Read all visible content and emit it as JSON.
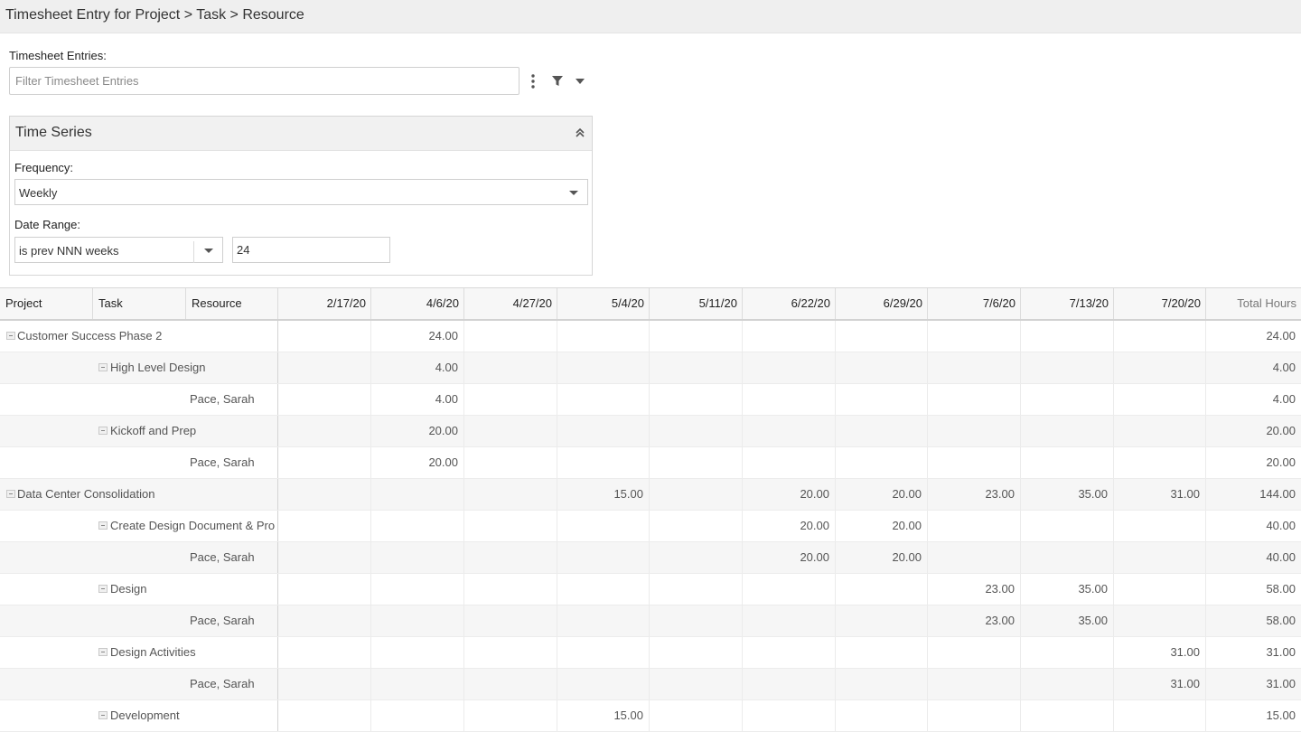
{
  "page_title": "Timesheet Entry for Project > Task > Resource",
  "filter": {
    "label": "Timesheet Entries:",
    "placeholder": "Filter Timesheet Entries"
  },
  "icons": {
    "more": "more-vertical-icon",
    "filter": "filter-icon",
    "dropdown": "chevron-down-icon",
    "collapse": "double-chevron-up-icon",
    "tree_toggle": "collapse-minus-icon"
  },
  "time_series": {
    "title": "Time Series",
    "frequency_label": "Frequency:",
    "frequency_value": "Weekly",
    "date_range_label": "Date Range:",
    "date_range_operator": "is prev NNN weeks",
    "date_range_value": "24"
  },
  "grid": {
    "headers": {
      "project": "Project",
      "task": "Task",
      "resource": "Resource",
      "dates": [
        "2/17/20",
        "4/6/20",
        "4/27/20",
        "5/4/20",
        "5/11/20",
        "6/22/20",
        "6/29/20",
        "7/6/20",
        "7/13/20",
        "7/20/20"
      ],
      "total": "Total Hours"
    },
    "rows": [
      {
        "level": "project",
        "label": "Customer Success Phase 2",
        "values": [
          "",
          "24.00",
          "",
          "",
          "",
          "",
          "",
          "",
          "",
          ""
        ],
        "total": "24.00"
      },
      {
        "level": "task",
        "label": "High Level Design",
        "values": [
          "",
          "4.00",
          "",
          "",
          "",
          "",
          "",
          "",
          "",
          ""
        ],
        "total": "4.00"
      },
      {
        "level": "resource",
        "label": "Pace, Sarah",
        "values": [
          "",
          "4.00",
          "",
          "",
          "",
          "",
          "",
          "",
          "",
          ""
        ],
        "total": "4.00"
      },
      {
        "level": "task",
        "label": "Kickoff and Prep",
        "values": [
          "",
          "20.00",
          "",
          "",
          "",
          "",
          "",
          "",
          "",
          ""
        ],
        "total": "20.00"
      },
      {
        "level": "resource",
        "label": "Pace, Sarah",
        "values": [
          "",
          "20.00",
          "",
          "",
          "",
          "",
          "",
          "",
          "",
          ""
        ],
        "total": "20.00"
      },
      {
        "level": "project",
        "label": "Data Center Consolidation",
        "values": [
          "",
          "",
          "",
          "15.00",
          "",
          "20.00",
          "20.00",
          "23.00",
          "35.00",
          "31.00"
        ],
        "total": "144.00"
      },
      {
        "level": "task",
        "label": "Create Design Document & Pro",
        "values": [
          "",
          "",
          "",
          "",
          "",
          "20.00",
          "20.00",
          "",
          "",
          ""
        ],
        "total": "40.00"
      },
      {
        "level": "resource",
        "label": "Pace, Sarah",
        "values": [
          "",
          "",
          "",
          "",
          "",
          "20.00",
          "20.00",
          "",
          "",
          ""
        ],
        "total": "40.00"
      },
      {
        "level": "task",
        "label": "Design",
        "values": [
          "",
          "",
          "",
          "",
          "",
          "",
          "",
          "23.00",
          "35.00",
          ""
        ],
        "total": "58.00"
      },
      {
        "level": "resource",
        "label": "Pace, Sarah",
        "values": [
          "",
          "",
          "",
          "",
          "",
          "",
          "",
          "23.00",
          "35.00",
          ""
        ],
        "total": "58.00"
      },
      {
        "level": "task",
        "label": "Design Activities",
        "values": [
          "",
          "",
          "",
          "",
          "",
          "",
          "",
          "",
          "",
          "31.00"
        ],
        "total": "31.00"
      },
      {
        "level": "resource",
        "label": "Pace, Sarah",
        "values": [
          "",
          "",
          "",
          "",
          "",
          "",
          "",
          "",
          "",
          "31.00"
        ],
        "total": "31.00"
      },
      {
        "level": "task",
        "label": "Development",
        "values": [
          "",
          "",
          "",
          "15.00",
          "",
          "",
          "",
          "",
          "",
          ""
        ],
        "total": "15.00"
      }
    ]
  }
}
